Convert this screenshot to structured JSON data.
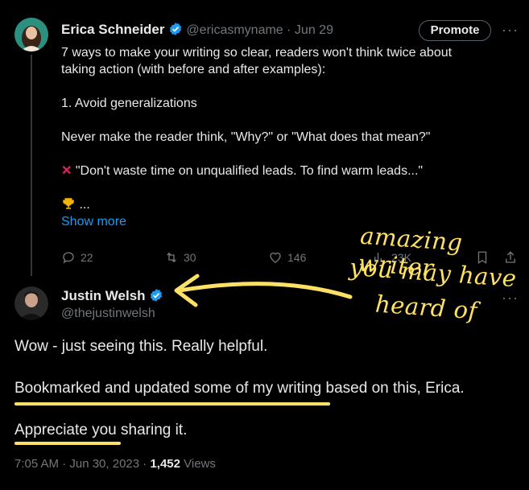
{
  "tweet": {
    "author_name": "Erica Schneider",
    "handle": "@ericasmyname",
    "date": "· Jun 29",
    "promote_label": "Promote",
    "line1": "7 ways to make your writing so clear, readers won't think twice about",
    "line2": "taking action (with before and after examples):",
    "point1": "1. Avoid generalizations",
    "point2": "Never make the reader think, \"Why?\" or \"What does that mean?\"",
    "point3": "\"Don't waste time on unqualified leads. To find warm leads...\"",
    "point4": "...",
    "show_more": "Show more",
    "replies": "22",
    "retweets": "30",
    "likes": "146",
    "views": "23K"
  },
  "reply": {
    "author_name": "Justin Welsh",
    "handle": "@thejustinwelsh",
    "line1": "Wow - just seeing this. Really helpful.",
    "line2": "Bookmarked and updated some of my writing based on this, Erica.",
    "line3": "Appreciate you sharing it.",
    "timestamp": "7:05 AM · Jun 30, 2023 · ",
    "view_count": "1,452",
    "views_label": " Views"
  },
  "annotation": {
    "line1": "amazing writer",
    "line2": "you may have",
    "line3": "heard of"
  },
  "colors": {
    "background": "#000000",
    "text": "#e7e9ea",
    "muted": "#71767b",
    "link": "#1d9bf0",
    "verified": "#1d9bf0",
    "annotation": "#ffe066"
  }
}
